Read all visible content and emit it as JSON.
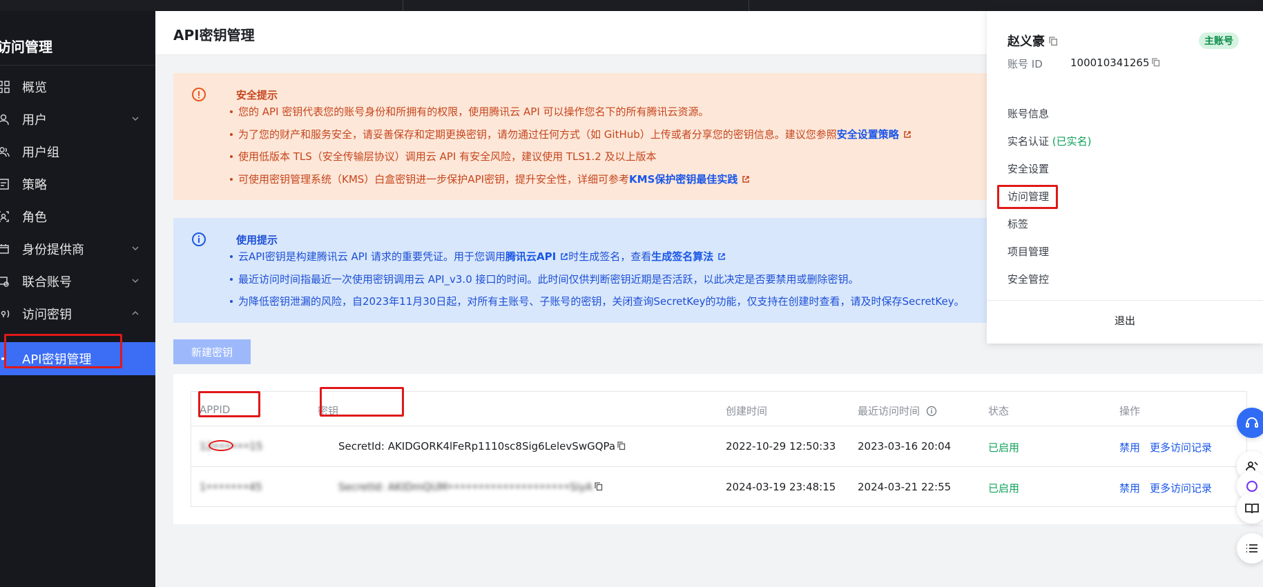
{
  "sidebar": {
    "title": "访问管理",
    "items": [
      {
        "label": "概览",
        "icon": "grid-icon"
      },
      {
        "label": "用户",
        "icon": "user-icon"
      },
      {
        "label": "用户组",
        "icon": "user-group-icon"
      },
      {
        "label": "策略",
        "icon": "policy-icon"
      },
      {
        "label": "角色",
        "icon": "role-icon"
      },
      {
        "label": "身份提供商",
        "icon": "identity-provider-icon"
      },
      {
        "label": "联合账号",
        "icon": "federated-account-icon"
      },
      {
        "label": "访问密钥",
        "icon": "access-key-icon"
      }
    ],
    "active_item": "API密钥管理"
  },
  "header": {
    "title": "API密钥管理"
  },
  "security_alert": {
    "title": "安全提示",
    "items": [
      {
        "text": "您的 API 密钥代表您的账号身份和所拥有的权限，使用腾讯云 API 可以操作您名下的所有腾讯云资源。"
      },
      {
        "text": "为了您的财产和服务安全，请妥善保存和定期更换密钥，请勿通过任何方式（如 GitHub）上传或者分享您的密钥信息。建议您参照",
        "link": "安全设置策略"
      },
      {
        "text": "使用低版本 TLS（安全传输层协议）调用云 API 有安全风险，建议使用 TLS1.2 及以上版本"
      },
      {
        "text": "可使用密钥管理系统（KMS）白盒密钥进一步保护API密钥，提升安全性，详细可参考",
        "link": "KMS保护密钥最佳实践"
      }
    ]
  },
  "usage_alert": {
    "title": "使用提示",
    "items": [
      {
        "pre": "云API密钥是构建腾讯云 API 请求的重要凭证。用于您调用",
        "link1": "腾讯云API",
        "mid": "时生成签名，查看",
        "link2": "生成签名算法"
      },
      {
        "text": "最近访问时间指最近一次使用密钥调用云 API_v3.0 接口的时间。此时间仅供判断密钥近期是否活跃，以此决定是否要禁用或删除密钥。"
      },
      {
        "text": "为降低密钥泄漏的风险，自2023年11月30日起，对所有主账号、子账号的密钥，关闭查询SecretKey的功能，仅支持在创建时查看，请及时保存SecretKey。"
      }
    ]
  },
  "new_key_button": "新建密钥",
  "table": {
    "headers": {
      "appid": "APPID",
      "key": "密钥",
      "created": "创建时间",
      "last_access": "最近访问时间",
      "status": "状态",
      "actions": "操作"
    },
    "rows": [
      {
        "appid": "12••••••15",
        "key": "SecretId: AKIDGORK4lFeRp1110sc8Sig6LelevSwGQPa",
        "created": "2022-10-29 12:50:33",
        "last_access": "2023-03-16 20:04",
        "status": "已启用",
        "disable": "禁用",
        "more": "更多访问记录"
      },
      {
        "appid": "1•••••••45",
        "key": "SecretId: AKIDmQUM••••••••••••••••••••SiyA",
        "created": "2024-03-19 23:48:15",
        "last_access": "2024-03-21 22:55",
        "status": "已启用",
        "disable": "禁用",
        "more": "更多访问记录"
      }
    ]
  },
  "account_panel": {
    "name": "赵义豪",
    "badge": "主账号",
    "id_label": "账号 ID",
    "id_value": "100010341265",
    "items": [
      "账号信息",
      "实名认证",
      "安全设置",
      "访问管理",
      "标签",
      "项目管理",
      "安全管控"
    ],
    "verified": "(已实名)",
    "logout": "退出"
  },
  "colors": {
    "accent": "#3b6ef5",
    "warn_bg": "#fde7d8",
    "info_bg": "#d8e7fb",
    "status_green": "#0ea15a",
    "annotation_red": "#e01818"
  }
}
